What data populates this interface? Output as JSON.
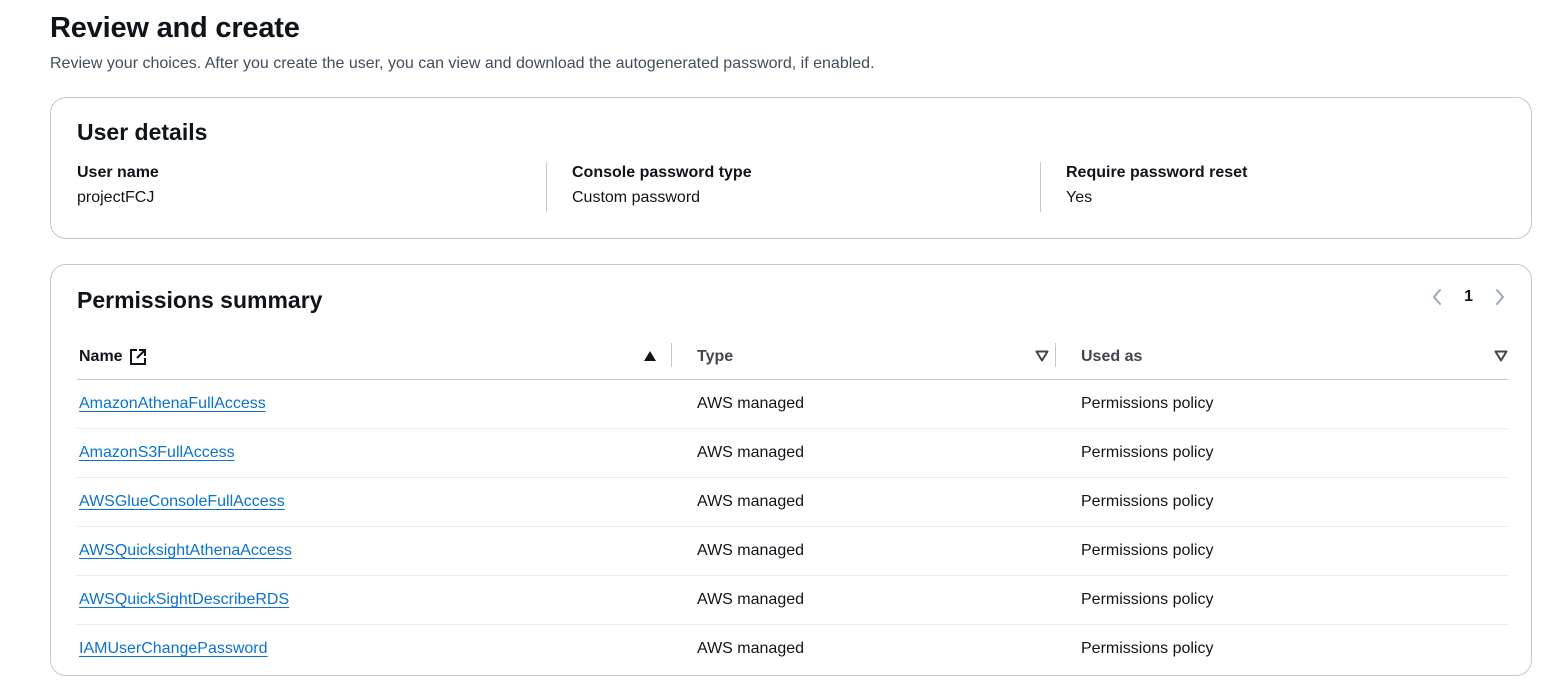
{
  "header": {
    "title": "Review and create",
    "description": "Review your choices. After you create the user, you can view and download the autogenerated password, if enabled."
  },
  "user_details": {
    "title": "User details",
    "fields": [
      {
        "label": "User name",
        "value": "projectFCJ"
      },
      {
        "label": "Console password type",
        "value": "Custom password"
      },
      {
        "label": "Require password reset",
        "value": "Yes"
      }
    ]
  },
  "permissions": {
    "title": "Permissions summary",
    "pagination": {
      "current_page": "1"
    },
    "columns": {
      "name": "Name",
      "type": "Type",
      "used_as": "Used as"
    },
    "rows": [
      {
        "name": "AmazonAthenaFullAccess",
        "type": "AWS managed",
        "used_as": "Permissions policy"
      },
      {
        "name": "AmazonS3FullAccess",
        "type": "AWS managed",
        "used_as": "Permissions policy"
      },
      {
        "name": "AWSGlueConsoleFullAccess",
        "type": "AWS managed",
        "used_as": "Permissions policy"
      },
      {
        "name": "AWSQuicksightAthenaAccess",
        "type": "AWS managed",
        "used_as": "Permissions policy"
      },
      {
        "name": "AWSQuickSightDescribeRDS",
        "type": "AWS managed",
        "used_as": "Permissions policy"
      },
      {
        "name": "IAMUserChangePassword",
        "type": "AWS managed",
        "used_as": "Permissions policy"
      }
    ]
  },
  "colors": {
    "link": "#0972d3",
    "text": "#0f141a",
    "muted_text": "#414d5c",
    "border": "#c6c6cd"
  },
  "icons": {
    "name_header": "external-link-icon",
    "name_sort": "sort-ascending-icon",
    "type_sort": "sort-descending-outline-icon",
    "used_sort": "sort-descending-outline-icon",
    "prev": "chevron-left-icon",
    "next": "chevron-right-icon"
  }
}
